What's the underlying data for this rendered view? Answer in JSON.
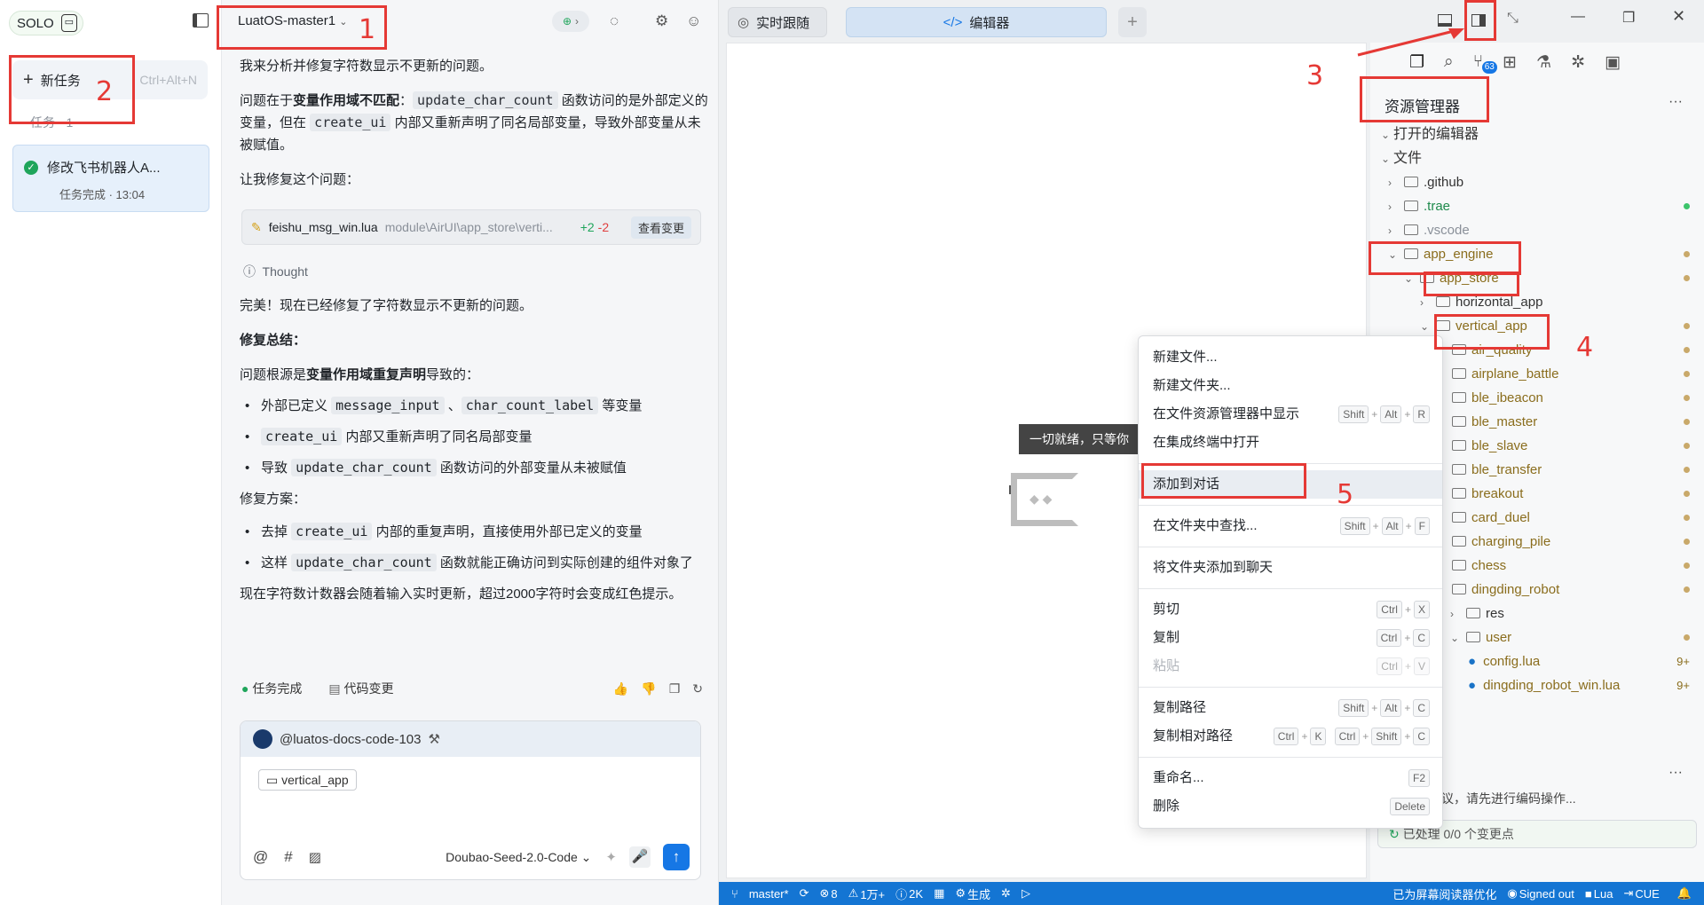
{
  "sidebar": {
    "solo_label": "SOLO",
    "new_task_label": "新任务",
    "new_task_shortcut": "Ctrl+Alt+N",
    "task_group_label": "任务 · 1",
    "task_title": "修改飞书机器人A...",
    "task_status": "任务完成 · 13:04"
  },
  "chat": {
    "branch": "LuatOS-master1",
    "intro": "我来分析并修复字符数显示不更新的问题。",
    "p1_a": "问题在于",
    "p1_b": "变量作用域不匹配",
    "p1_c": "：",
    "p1_code1": "update_char_count",
    "p1_d": " 函数访问的是外部定义的变量，但在 ",
    "p1_code2": "create_ui",
    "p1_e": " 内部又重新声明了同名局部变量，导致外部变量从未被赋值。",
    "fix_intro": "让我修复这个问题：",
    "file_name": "feishu_msg_win.lua",
    "file_path": "module\\AirUI\\app_store\\verti...",
    "file_add": "+2",
    "file_del": "-2",
    "view_changes": "查看变更",
    "thought": "Thought",
    "done": "完美！现在已经修复了字符数显示不更新的问题。",
    "summary_title": "修复总结：",
    "root_a": "问题根源是",
    "root_b": "变量作用域重复声明",
    "root_c": "导致的：",
    "b1_a": "外部已定义 ",
    "b1_code1": "message_input",
    "b1_b": " 、",
    "b1_code2": "char_count_label",
    "b1_c": " 等变量",
    "b2_code": "create_ui",
    "b2_a": " 内部又重新声明了同名局部变量",
    "b3_a": "导致 ",
    "b3_code": "update_char_count",
    "b3_b": " 函数访问的外部变量从未被赋值",
    "plan_title": "修复方案：",
    "s1_a": "去掉 ",
    "s1_code": "create_ui",
    "s1_b": " 内部的重复声明，直接使用外部已定义的变量",
    "s2_a": "这样 ",
    "s2_code": "update_char_count",
    "s2_b": " 函数就能正确访问到实际创建的组件对象了",
    "conclusion": "现在字符数计数器会随着输入实时更新，超过2000字符时会变成红色提示。",
    "status_done": "任务完成",
    "code_changes": "代码变更",
    "agent": "@luatos-docs-code-103",
    "context_chip": "vertical_app",
    "model": "Doubao-Seed-2.0-Code"
  },
  "tabs": {
    "follow": "实时跟随",
    "editor": "编辑器",
    "add": "+"
  },
  "editor": {
    "ready_text": "一切就绪，只等你"
  },
  "explorer": {
    "title": "资源管理器",
    "scm_badge": "63",
    "open_editors": "打开的编辑器",
    "files": "文件",
    "items": [
      {
        "label": ".github",
        "status": ""
      },
      {
        "label": ".trae",
        "status": "green"
      },
      {
        "label": ".vscode",
        "status": ""
      },
      {
        "label": "app_engine",
        "status": "mod"
      },
      {
        "label": "app_store",
        "status": "mod"
      },
      {
        "label": "horizontal_app",
        "status": ""
      },
      {
        "label": "vertical_app",
        "status": "mod"
      },
      {
        "label": "air_quality",
        "status": "mod"
      },
      {
        "label": "airplane_battle",
        "status": "mod"
      },
      {
        "label": "ble_ibeacon",
        "status": "mod"
      },
      {
        "label": "ble_master",
        "status": "mod"
      },
      {
        "label": "ble_slave",
        "status": "mod"
      },
      {
        "label": "ble_transfer",
        "status": "mod"
      },
      {
        "label": "breakout",
        "status": "mod"
      },
      {
        "label": "card_duel",
        "status": "mod"
      },
      {
        "label": "charging_pile",
        "status": "mod"
      },
      {
        "label": "chess",
        "status": "mod"
      },
      {
        "label": "dingding_robot",
        "status": "mod"
      },
      {
        "label": "res",
        "status": ""
      },
      {
        "label": "user",
        "status": "mod"
      },
      {
        "label": "config.lua",
        "status": "9+"
      },
      {
        "label": "dingding_robot_win.lua",
        "status": "9+"
      }
    ],
    "scm_hint": "议，请先进行编码操作...",
    "scm_processed": "已处理 0/0 个变更点"
  },
  "context_menu": [
    {
      "label": "新建文件...",
      "keys": []
    },
    {
      "label": "新建文件夹...",
      "keys": []
    },
    {
      "label": "在文件资源管理器中显示",
      "keys": [
        "Shift",
        "Alt",
        "R"
      ]
    },
    {
      "label": "在集成终端中打开",
      "keys": []
    },
    {
      "sep": true
    },
    {
      "label": "添加到对话",
      "keys": [],
      "highlight": true
    },
    {
      "sep": true
    },
    {
      "label": "在文件夹中查找...",
      "keys": [
        "Shift",
        "Alt",
        "F"
      ]
    },
    {
      "sep": true
    },
    {
      "label": "将文件夹添加到聊天",
      "keys": []
    },
    {
      "sep": true
    },
    {
      "label": "剪切",
      "keys": [
        "Ctrl",
        "X"
      ]
    },
    {
      "label": "复制",
      "keys": [
        "Ctrl",
        "C"
      ]
    },
    {
      "label": "粘贴",
      "keys": [
        "Ctrl",
        "V"
      ],
      "disabled": true
    },
    {
      "sep": true
    },
    {
      "label": "复制路径",
      "keys": [
        "Shift",
        "Alt",
        "C"
      ]
    },
    {
      "label": "复制相对路径",
      "keys": [
        "Ctrl",
        "K",
        "|",
        "Ctrl",
        "Shift",
        "C"
      ]
    },
    {
      "sep": true
    },
    {
      "label": "重命名...",
      "keys": [
        "F2"
      ]
    },
    {
      "label": "删除",
      "keys": [
        "Delete"
      ]
    }
  ],
  "status_bar": {
    "branch": "master*",
    "errors": "8",
    "warnings": "1万+",
    "infos": "2K",
    "generate": "生成",
    "screen_reader": "已为屏幕阅读器优化",
    "signed_out": "Signed out",
    "language": "Lua",
    "cue": "CUE"
  },
  "annotations": [
    "1",
    "2",
    "3",
    "4",
    "5"
  ],
  "colors": {
    "accent": "#1677e5",
    "status_bar": "#1475d3",
    "annotation": "#e53935",
    "success": "#1fa55b"
  }
}
